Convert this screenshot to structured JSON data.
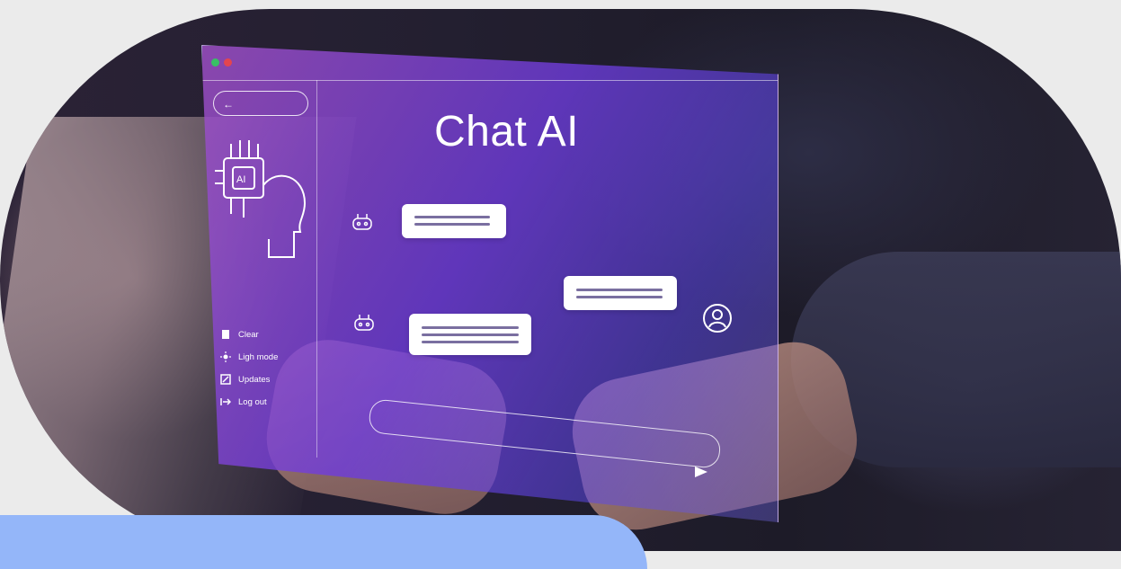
{
  "image": {
    "screen_title": "Chat AI",
    "sidebar_menu": [
      {
        "label": "Clear",
        "icon": "trash-icon"
      },
      {
        "label": "Ligh mode",
        "icon": "sun-icon"
      },
      {
        "label": "Updates",
        "icon": "edit-icon"
      },
      {
        "label": "Log out",
        "icon": "logout-icon"
      }
    ],
    "back_arrow": "←",
    "window_dots": [
      "#39c064",
      "#e3454f"
    ],
    "colors": {
      "screen_purple": "#7a4fe0",
      "band_blue": "#94b6f9",
      "background_gray": "#ebebeb"
    }
  }
}
